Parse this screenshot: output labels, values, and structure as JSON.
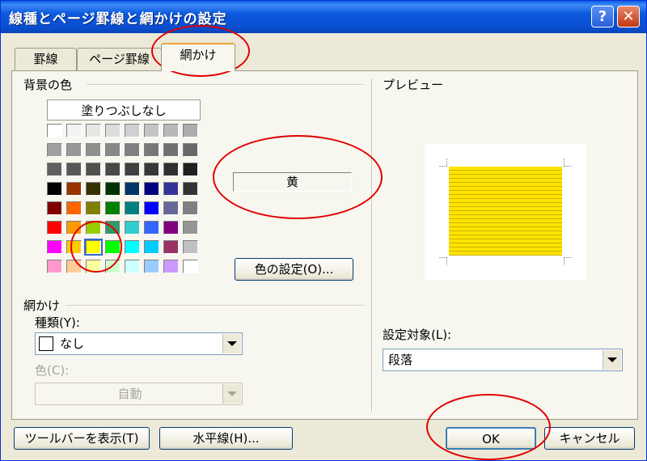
{
  "dialog": {
    "title": "線種とページ罫線と網かけの設定",
    "help_button": "?",
    "close_button": "✕"
  },
  "tabs": [
    {
      "label": "罫線"
    },
    {
      "label": "ページ罫線"
    },
    {
      "label": "網かけ"
    }
  ],
  "background": {
    "group_label": "背景の色",
    "no_fill_label": "塗りつぶしなし",
    "selected_color_name": "黄",
    "more_colors_button": "色の設定(O)...",
    "palette": [
      [
        "#ffffff",
        "#f2f2f2",
        "#e6e6e6",
        "#dcdcdc",
        "#d0d0d0",
        "#c4c4c4",
        "#b8b8b8",
        "#acacac"
      ],
      [
        "#a0a0a0",
        "#989898",
        "#909090",
        "#888888",
        "#808080",
        "#787878",
        "#707070",
        "#686868"
      ],
      [
        "#606060",
        "#585858",
        "#505050",
        "#484848",
        "#404040",
        "#383838",
        "#303030",
        "#202020"
      ],
      [
        "#000000",
        "#993300",
        "#333300",
        "#003300",
        "#003366",
        "#000080",
        "#333399",
        "#333333"
      ],
      [
        "#800000",
        "#ff6600",
        "#808000",
        "#008000",
        "#008080",
        "#0000ff",
        "#666699",
        "#808080"
      ],
      [
        "#ff0000",
        "#ff9900",
        "#99cc00",
        "#339966",
        "#33cccc",
        "#3366ff",
        "#800080",
        "#969696"
      ],
      [
        "#ff00ff",
        "#ffcc00",
        "#ffff00",
        "#00ff00",
        "#00ffff",
        "#00ccff",
        "#993366",
        "#c0c0c0"
      ],
      [
        "#ff99cc",
        "#ffcc99",
        "#ffff99",
        "#ccffcc",
        "#ccffff",
        "#99ccff",
        "#cc99ff",
        "#ffffff"
      ]
    ],
    "selected_swatch": [
      6,
      2
    ]
  },
  "shading": {
    "group_label": "網かけ",
    "style_label": "種類(Y):",
    "style_value": "なし",
    "color_label": "色(C):",
    "color_value": "自動"
  },
  "preview": {
    "label": "プレビュー",
    "apply_to_label": "設定対象(L):",
    "apply_to_value": "段落"
  },
  "footer": {
    "toolbar_button": "ツールバーを表示(T)",
    "horizontal_line_button": "水平線(H)...",
    "ok_button": "OK",
    "cancel_button": "キャンセル"
  },
  "colors": {
    "title_bar": "#0a4fd1",
    "dialog_bg": "#ece9d8",
    "panel_bg": "#f7f6ef",
    "preview_fill": "#ffe400",
    "annotation": "#e00000"
  }
}
